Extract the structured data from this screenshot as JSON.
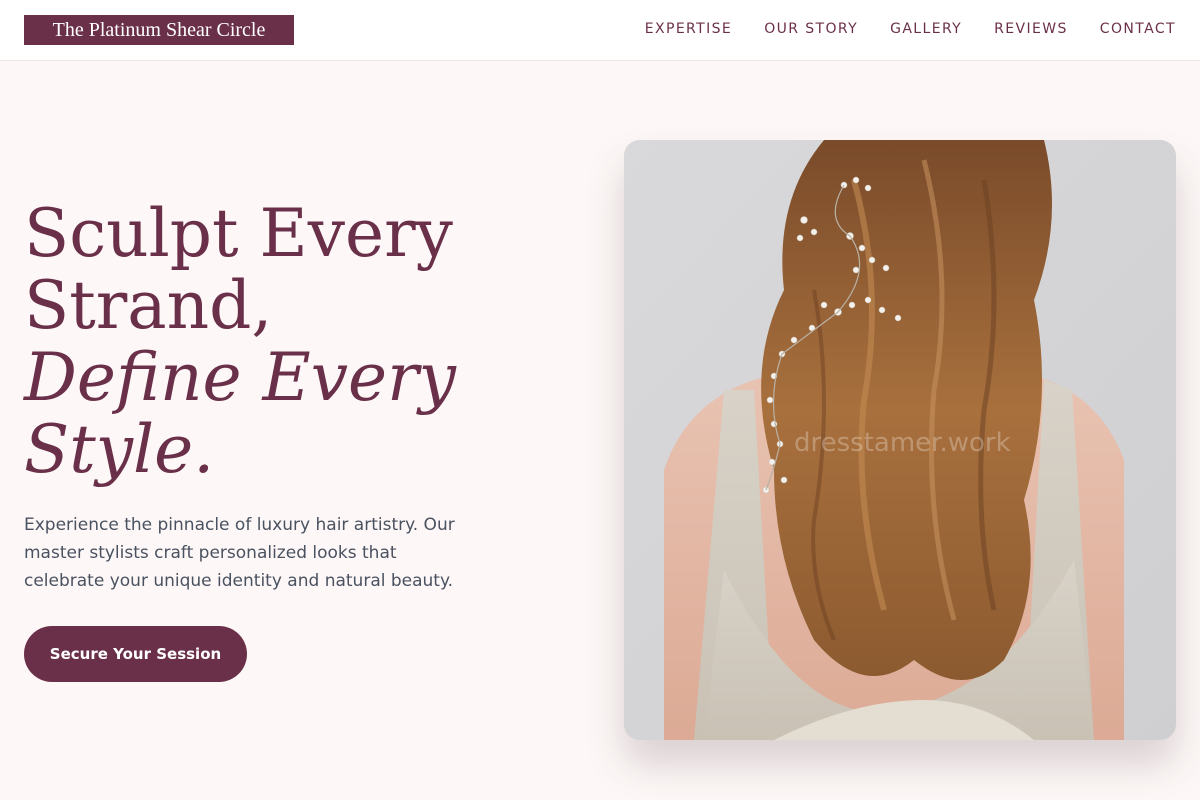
{
  "brand": {
    "name": "The Platinum Shear Circle",
    "accent": "#6b3049",
    "background": "#fdf8f7"
  },
  "nav": {
    "items": [
      {
        "label": "EXPERTISE"
      },
      {
        "label": "OUR STORY"
      },
      {
        "label": "GALLERY"
      },
      {
        "label": "REVIEWS"
      },
      {
        "label": "CONTACT"
      }
    ]
  },
  "hero": {
    "headline_line1": "Sculpt Every",
    "headline_line2": "Strand,",
    "headline_line3": "Define Every",
    "headline_line4": "Style.",
    "description": "Experience the pinnacle of luxury hair artistry. Our master stylists craft personalized looks that celebrate your unique identity and natural beauty.",
    "cta_label": "Secure Your Session",
    "image_watermark": "dresstamer.work"
  }
}
